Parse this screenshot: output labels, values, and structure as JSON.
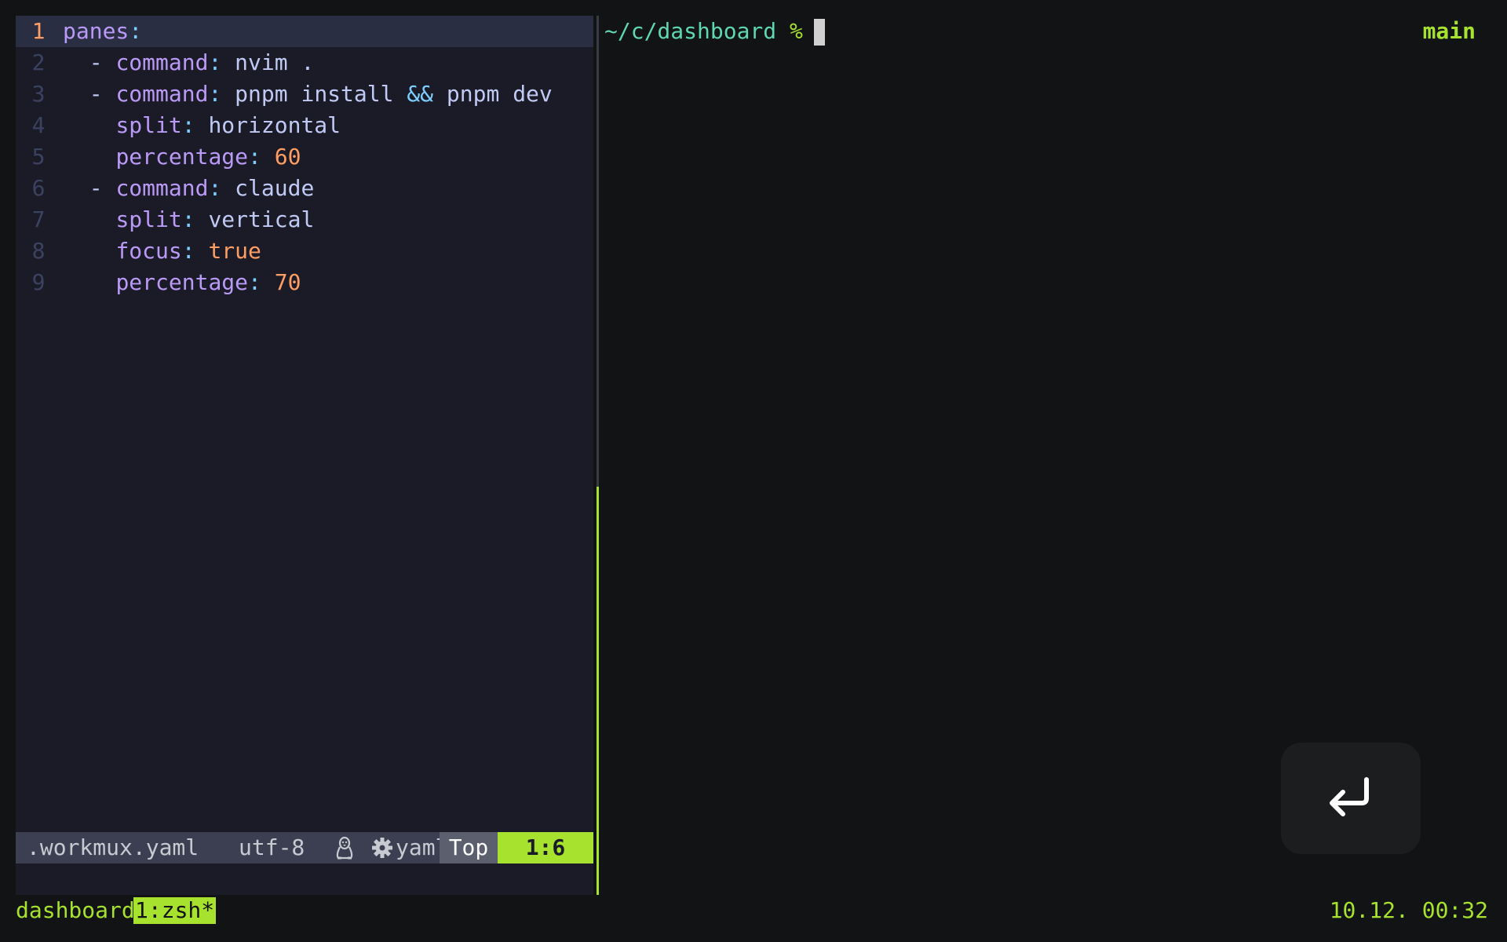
{
  "editor": {
    "lines": [
      {
        "num": "1",
        "current": true,
        "tokens": [
          {
            "t": "panes",
            "c": "k"
          },
          {
            "t": ":",
            "c": "p"
          }
        ]
      },
      {
        "num": "2",
        "tokens": [
          {
            "t": "  ",
            "c": "v"
          },
          {
            "t": "-",
            "c": "d"
          },
          {
            "t": " ",
            "c": "v"
          },
          {
            "t": "command",
            "c": "k"
          },
          {
            "t": ":",
            "c": "p"
          },
          {
            "t": " nvim .",
            "c": "v"
          }
        ]
      },
      {
        "num": "3",
        "tokens": [
          {
            "t": "  ",
            "c": "v"
          },
          {
            "t": "-",
            "c": "d"
          },
          {
            "t": " ",
            "c": "v"
          },
          {
            "t": "command",
            "c": "k"
          },
          {
            "t": ":",
            "c": "p"
          },
          {
            "t": " pnpm install ",
            "c": "v"
          },
          {
            "t": "&&",
            "c": "o"
          },
          {
            "t": " pnpm dev",
            "c": "v"
          }
        ]
      },
      {
        "num": "4",
        "tokens": [
          {
            "t": "    ",
            "c": "v"
          },
          {
            "t": "split",
            "c": "k"
          },
          {
            "t": ":",
            "c": "p"
          },
          {
            "t": " horizontal",
            "c": "v"
          }
        ]
      },
      {
        "num": "5",
        "tokens": [
          {
            "t": "    ",
            "c": "v"
          },
          {
            "t": "percentage",
            "c": "k"
          },
          {
            "t": ":",
            "c": "p"
          },
          {
            "t": " ",
            "c": "v"
          },
          {
            "t": "60",
            "c": "n"
          }
        ]
      },
      {
        "num": "6",
        "tokens": [
          {
            "t": "  ",
            "c": "v"
          },
          {
            "t": "-",
            "c": "d"
          },
          {
            "t": " ",
            "c": "v"
          },
          {
            "t": "command",
            "c": "k"
          },
          {
            "t": ":",
            "c": "p"
          },
          {
            "t": " claude",
            "c": "v"
          }
        ]
      },
      {
        "num": "7",
        "tokens": [
          {
            "t": "    ",
            "c": "v"
          },
          {
            "t": "split",
            "c": "k"
          },
          {
            "t": ":",
            "c": "p"
          },
          {
            "t": " vertical",
            "c": "v"
          }
        ]
      },
      {
        "num": "8",
        "tokens": [
          {
            "t": "    ",
            "c": "v"
          },
          {
            "t": "focus",
            "c": "k"
          },
          {
            "t": ":",
            "c": "p"
          },
          {
            "t": " ",
            "c": "v"
          },
          {
            "t": "true",
            "c": "n"
          }
        ]
      },
      {
        "num": "9",
        "tokens": [
          {
            "t": "    ",
            "c": "v"
          },
          {
            "t": "percentage",
            "c": "k"
          },
          {
            "t": ":",
            "c": "p"
          },
          {
            "t": " ",
            "c": "v"
          },
          {
            "t": "70",
            "c": "n"
          }
        ]
      }
    ],
    "statusline": {
      "filename": ".workmux.yaml",
      "encoding": "utf-8",
      "os_icon": "linux-penguin-icon",
      "filetype_icon": "gear-icon",
      "filetype": "yaml",
      "position": "Top",
      "cursor": "1:6"
    }
  },
  "shell": {
    "prompt_path": "~/c/dashboard",
    "prompt_symbol": "%",
    "git_branch": "main"
  },
  "overlay": {
    "icon": "enter-key-icon"
  },
  "tmux": {
    "session": "dashboard",
    "window": "1:zsh*",
    "clock": "10.12. 00:32"
  },
  "colors": {
    "accent": "#a6e22e",
    "editor_bg": "#1a1b26",
    "terminal_bg": "#121314",
    "yaml_key": "#bb9af7",
    "yaml_number": "#ff9e64",
    "prompt_path": "#5fd7af"
  }
}
